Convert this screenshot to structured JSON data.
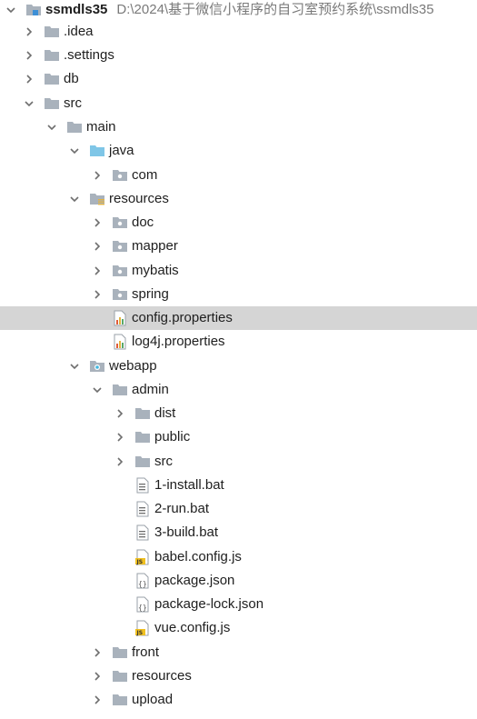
{
  "tree": {
    "root": {
      "label": "ssmdls35",
      "path": "D:\\2024\\基于微信小程序的自习室预约系统\\ssmdls35"
    },
    "items": [
      {
        "label": ".idea"
      },
      {
        "label": ".settings"
      },
      {
        "label": "db"
      },
      {
        "label": "src"
      },
      {
        "label": "main"
      },
      {
        "label": "java"
      },
      {
        "label": "com"
      },
      {
        "label": "resources"
      },
      {
        "label": "doc"
      },
      {
        "label": "mapper"
      },
      {
        "label": "mybatis"
      },
      {
        "label": "spring"
      },
      {
        "label": "config.properties"
      },
      {
        "label": "log4j.properties"
      },
      {
        "label": "webapp"
      },
      {
        "label": "admin"
      },
      {
        "label": "dist"
      },
      {
        "label": "public"
      },
      {
        "label": "src"
      },
      {
        "label": "1-install.bat"
      },
      {
        "label": "2-run.bat"
      },
      {
        "label": "3-build.bat"
      },
      {
        "label": "babel.config.js"
      },
      {
        "label": "package.json"
      },
      {
        "label": "package-lock.json"
      },
      {
        "label": "vue.config.js"
      },
      {
        "label": "front"
      },
      {
        "label": "resources"
      },
      {
        "label": "upload"
      }
    ]
  },
  "colors": {
    "selected_row": "#d5d5d5",
    "folder_gray": "#a9b2bc",
    "folder_blue": "#7fc6e7",
    "path_text": "#7a7a7a"
  },
  "icons": [
    "module-folder-icon",
    "folder-icon",
    "source-folder-icon",
    "resources-folder-icon",
    "package-icon",
    "properties-file-icon",
    "web-folder-icon",
    "text-file-icon",
    "js-file-icon",
    "json-file-icon"
  ]
}
